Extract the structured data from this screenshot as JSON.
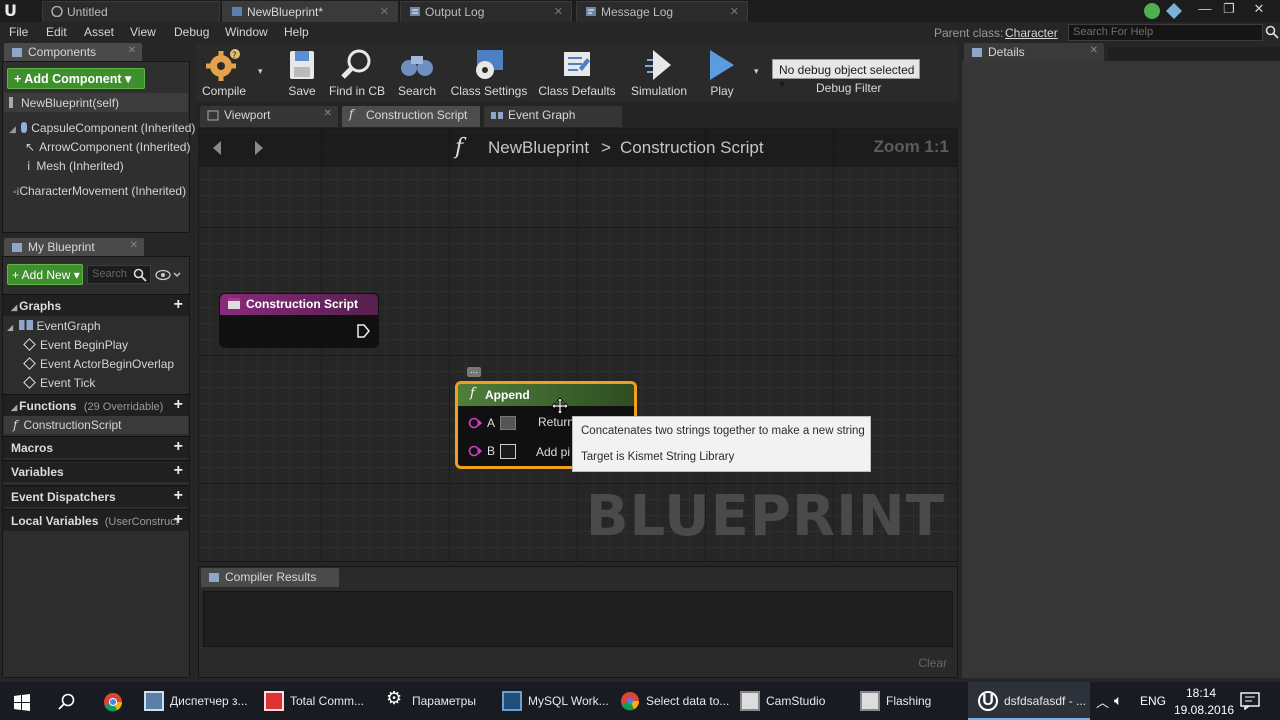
{
  "titlebar": {
    "tabs": [
      {
        "label": "Untitled",
        "icon": "ue-level-icon"
      },
      {
        "label": "NewBlueprint*",
        "icon": "blueprint-icon"
      },
      {
        "label": "Output Log",
        "icon": "log-icon"
      },
      {
        "label": "Message Log",
        "icon": "message-icon"
      }
    ],
    "window_buttons": [
      "minimize",
      "restore",
      "close"
    ]
  },
  "menu": {
    "items": [
      "File",
      "Edit",
      "Asset",
      "View",
      "Debug",
      "Window",
      "Help"
    ],
    "parent_class_label": "Parent class:",
    "parent_class_value": "Character",
    "help_search_placeholder": "Search For Help"
  },
  "components": {
    "tab_label": "Components",
    "add_button": "+ Add Component ▾",
    "items": [
      "NewBlueprint(self)",
      "CapsuleComponent (Inherited)",
      "ArrowComponent (Inherited)",
      "Mesh (Inherited)",
      "CharacterMovement (Inherited)"
    ]
  },
  "my_blueprint": {
    "tab_label": "My Blueprint",
    "add_new": "+ Add New ▾",
    "search_placeholder": "Search",
    "sections": {
      "graphs": "Graphs",
      "event_graph": "EventGraph",
      "events": [
        "Event BeginPlay",
        "Event ActorBeginOverlap",
        "Event Tick"
      ],
      "functions": "Functions",
      "functions_count": "(29 Overridable)",
      "construction_script": "ConstructionScript",
      "macros": "Macros",
      "variables": "Variables",
      "event_dispatchers": "Event Dispatchers",
      "local_variables": "Local Variables",
      "local_variables_scope": "(UserConstruct"
    }
  },
  "toolbar": {
    "buttons": [
      "Compile",
      "Save",
      "Find in CB",
      "Search",
      "Class Settings",
      "Class Defaults",
      "Simulation",
      "Play"
    ],
    "debug_select": "No debug object selected ▾",
    "debug_filter": "Debug Filter"
  },
  "editor_tabs": [
    "Viewport",
    "Construction Script",
    "Event Graph"
  ],
  "graph": {
    "breadcrumb_root": "NewBlueprint",
    "breadcrumb_separator": ">",
    "breadcrumb_current": "Construction Script",
    "zoom": "Zoom 1:1",
    "watermark": "BLUEPRINT",
    "construction_node_title": "Construction Script",
    "append_node": {
      "title": "Append",
      "pin_a": "A",
      "pin_b": "B",
      "return_label": "Return",
      "add_pin_label": "Add pi"
    },
    "comment_bubble": "..."
  },
  "tooltip": {
    "line1": "Concatenates two strings together to make a new string",
    "line2": "Target is Kismet String Library"
  },
  "compiler": {
    "tab_label": "Compiler Results",
    "clear_button": "Clear"
  },
  "details": {
    "tab_label": "Details"
  },
  "taskbar": {
    "items": [
      {
        "label": "",
        "icon": "windows-start-icon"
      },
      {
        "label": "",
        "icon": "search-icon"
      },
      {
        "label": "",
        "icon": "chrome-icon"
      },
      {
        "label": "Диспетчер з...",
        "icon": "task-manager-icon"
      },
      {
        "label": "Total Comm...",
        "icon": "total-commander-icon"
      },
      {
        "label": "Параметры",
        "icon": "settings-icon"
      },
      {
        "label": "MySQL Work...",
        "icon": "mysql-icon"
      },
      {
        "label": "Select data to...",
        "icon": "chrome-icon"
      },
      {
        "label": "CamStudio",
        "icon": "camstudio-icon"
      },
      {
        "label": "Flashing",
        "icon": "flashing-icon"
      },
      {
        "label": "dsfdsafasdf - ...",
        "icon": "ue-icon"
      }
    ],
    "language": "ENG",
    "time": "18:14",
    "date": "19.08.2016"
  },
  "colors": {
    "accent_green": "#3f8f2e",
    "node_purple": "#8a2a7c",
    "node_green": "#3f6e28",
    "selection_orange": "#f0a020",
    "pin_magenta": "#d63cc7"
  }
}
